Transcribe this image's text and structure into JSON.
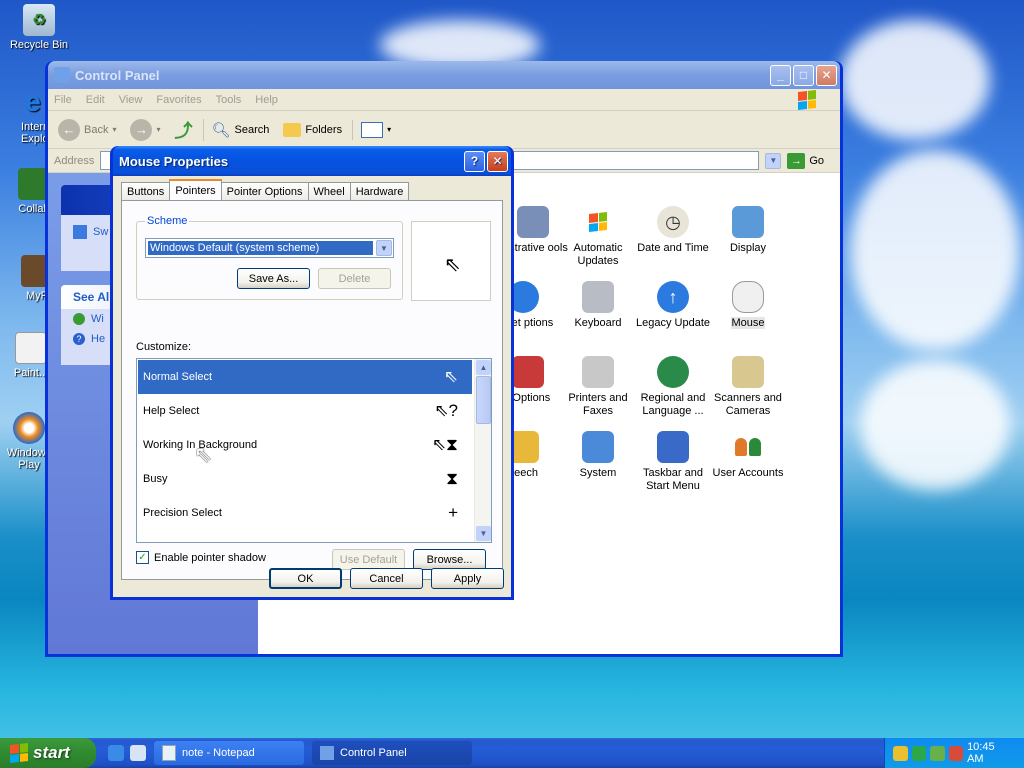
{
  "desktop": {
    "icons": [
      {
        "label": "Recycle Bin"
      },
      {
        "label": "Internet Explorer"
      },
      {
        "label": "Collab"
      },
      {
        "label": "MyP"
      },
      {
        "label": "Paint..."
      },
      {
        "label": "Windows Play"
      }
    ]
  },
  "control_panel": {
    "title": "Control Panel",
    "menu": [
      "File",
      "Edit",
      "View",
      "Favorites",
      "Tools",
      "Help"
    ],
    "toolbar": {
      "back": "Back",
      "search": "Search",
      "folders": "Folders"
    },
    "address_label": "Address",
    "go_label": "Go",
    "left_tasks": {
      "switch_label": "Sw",
      "see_also": "See Al",
      "item1": "Wi",
      "item2": "He"
    },
    "items": [
      {
        "label": "inistrative ools"
      },
      {
        "label": "Automatic Updates"
      },
      {
        "label": "Date and Time"
      },
      {
        "label": "Display"
      },
      {
        "label": "ternet ptions"
      },
      {
        "label": "Keyboard"
      },
      {
        "label": "Legacy Update"
      },
      {
        "label": "Mouse"
      },
      {
        "label": "r Options"
      },
      {
        "label": "Printers and Faxes"
      },
      {
        "label": "Regional and Language ..."
      },
      {
        "label": "Scanners and Cameras"
      },
      {
        "label": "beech"
      },
      {
        "label": "System"
      },
      {
        "label": "Taskbar and Start Menu"
      },
      {
        "label": "User Accounts"
      }
    ]
  },
  "mouse_dialog": {
    "title": "Mouse Properties",
    "tabs": [
      "Buttons",
      "Pointers",
      "Pointer Options",
      "Wheel",
      "Hardware"
    ],
    "scheme_label": "Scheme",
    "scheme_value": "Windows Default (system scheme)",
    "save_as_label": "Save As...",
    "delete_label": "Delete",
    "customize_label": "Customize:",
    "pointers": [
      {
        "label": "Normal Select",
        "cursor": "⇖"
      },
      {
        "label": "Help Select",
        "cursor": "⇖?"
      },
      {
        "label": "Working In Background",
        "cursor": "⇖⧗"
      },
      {
        "label": "Busy",
        "cursor": "⧗"
      },
      {
        "label": "Precision Select",
        "cursor": "+"
      }
    ],
    "shadow_label": "Enable pointer shadow",
    "shadow_checked": true,
    "use_default_label": "Use Default",
    "browse_label": "Browse...",
    "ok_label": "OK",
    "cancel_label": "Cancel",
    "apply_label": "Apply"
  },
  "taskbar": {
    "start_label": "start",
    "tasks": [
      {
        "label": "note - Notepad"
      },
      {
        "label": "Control Panel"
      }
    ],
    "clock": "10:45 AM"
  }
}
